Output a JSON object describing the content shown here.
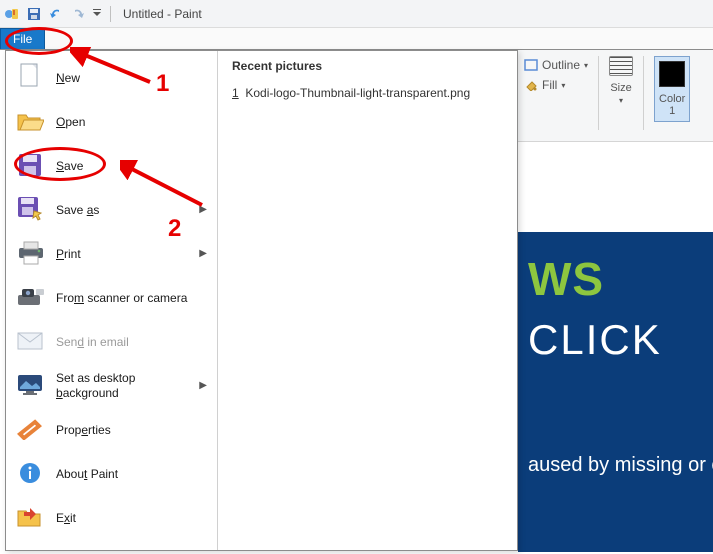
{
  "window": {
    "title": "Untitled - Paint"
  },
  "tabs": {
    "file": "File"
  },
  "file_menu": {
    "items": [
      {
        "label": "New",
        "u": "N",
        "rest": "ew"
      },
      {
        "label": "Open",
        "u": "O",
        "rest": "pen"
      },
      {
        "label": "Save",
        "u": "S",
        "rest": "ave"
      },
      {
        "label": "Save as",
        "u": "a",
        "pre": "Save ",
        "rest": "s",
        "submenu": true
      },
      {
        "label": "Print",
        "u": "P",
        "rest": "rint",
        "submenu": true
      },
      {
        "label": "From scanner or camera",
        "u": "m",
        "pre": "Fro",
        "rest": " scanner or camera"
      },
      {
        "label": "Send in email",
        "u": "d",
        "pre": "Sen",
        "rest": " in email",
        "disabled": true
      },
      {
        "label": "Set as desktop background",
        "u": "b",
        "pre": "Set as desktop ",
        "rest": "ackground",
        "submenu": true
      },
      {
        "label": "Properties",
        "u": "e",
        "pre": "Prop",
        "rest": "rties"
      },
      {
        "label": "About Paint",
        "u": "t",
        "pre": "Abou",
        "rest": " Paint"
      },
      {
        "label": "Exit",
        "u": "x",
        "pre": "E",
        "rest": "it"
      }
    ],
    "recent_header": "Recent pictures",
    "recent": [
      {
        "idx": "1",
        "name": "Kodi-logo-Thumbnail-light-transparent.png"
      }
    ]
  },
  "ribbon": {
    "outline": "Outline",
    "fill": "Fill",
    "size": "Size",
    "color1": "Color\n1"
  },
  "ad": {
    "line1": "WS",
    "line2": " CLICK",
    "line3": "aused by missing or c"
  },
  "annotations": {
    "n1": "1",
    "n2": "2"
  }
}
